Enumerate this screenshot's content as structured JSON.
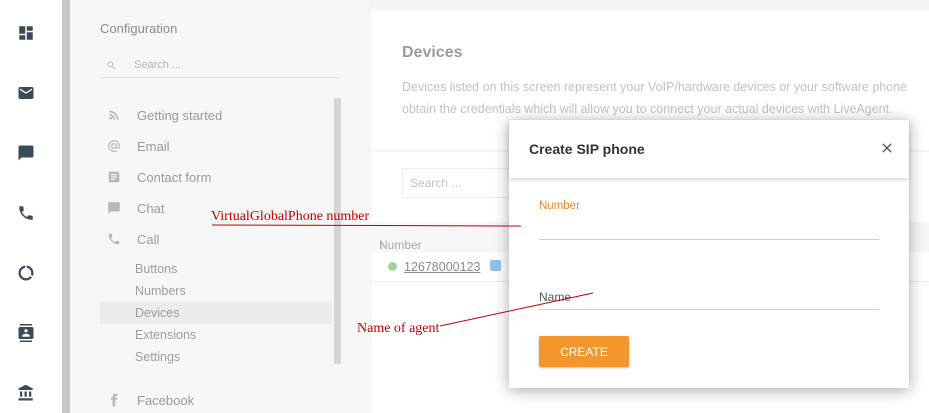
{
  "rail": {
    "icons": [
      "dashboard-icon",
      "mail-icon",
      "chat-icon",
      "phone-icon",
      "reports-icon",
      "contacts-icon",
      "bank-icon"
    ]
  },
  "config": {
    "title": "Configuration",
    "search_placeholder": "Search ...",
    "nav": [
      {
        "label": "Getting started",
        "icon": "rss-icon"
      },
      {
        "label": "Email",
        "icon": "at-icon"
      },
      {
        "label": "Contact form",
        "icon": "form-icon"
      },
      {
        "label": "Chat",
        "icon": "chat-icon"
      },
      {
        "label": "Call",
        "icon": "phone-icon"
      }
    ],
    "call_sub": [
      {
        "label": "Buttons",
        "active": false
      },
      {
        "label": "Numbers",
        "active": false
      },
      {
        "label": "Devices",
        "active": true
      },
      {
        "label": "Extensions",
        "active": false
      },
      {
        "label": "Settings",
        "active": false
      }
    ],
    "facebook": {
      "label": "Facebook",
      "icon": "facebook-icon"
    }
  },
  "devices": {
    "title": "Devices",
    "desc_line1": "Devices listed on this screen represent your VoIP/hardware devices or your software phone",
    "desc_line2": "obtain the credentials which will allow you to connect your actual devices with LiveAgent.",
    "search_placeholder": "Search ...",
    "column_header": "Number",
    "rows": [
      {
        "number": "12678000123",
        "status_color": "#9fd49f"
      }
    ]
  },
  "modal": {
    "title": "Create SIP phone",
    "number_label": "Number",
    "number_value": "",
    "name_label": "Name",
    "name_value": "",
    "create_label": "CREATE",
    "accent": "#f3962c"
  },
  "annotations": {
    "number_note": "VirtualGlobalPhone number",
    "name_note": "Name of agent",
    "color": "#c00000"
  }
}
